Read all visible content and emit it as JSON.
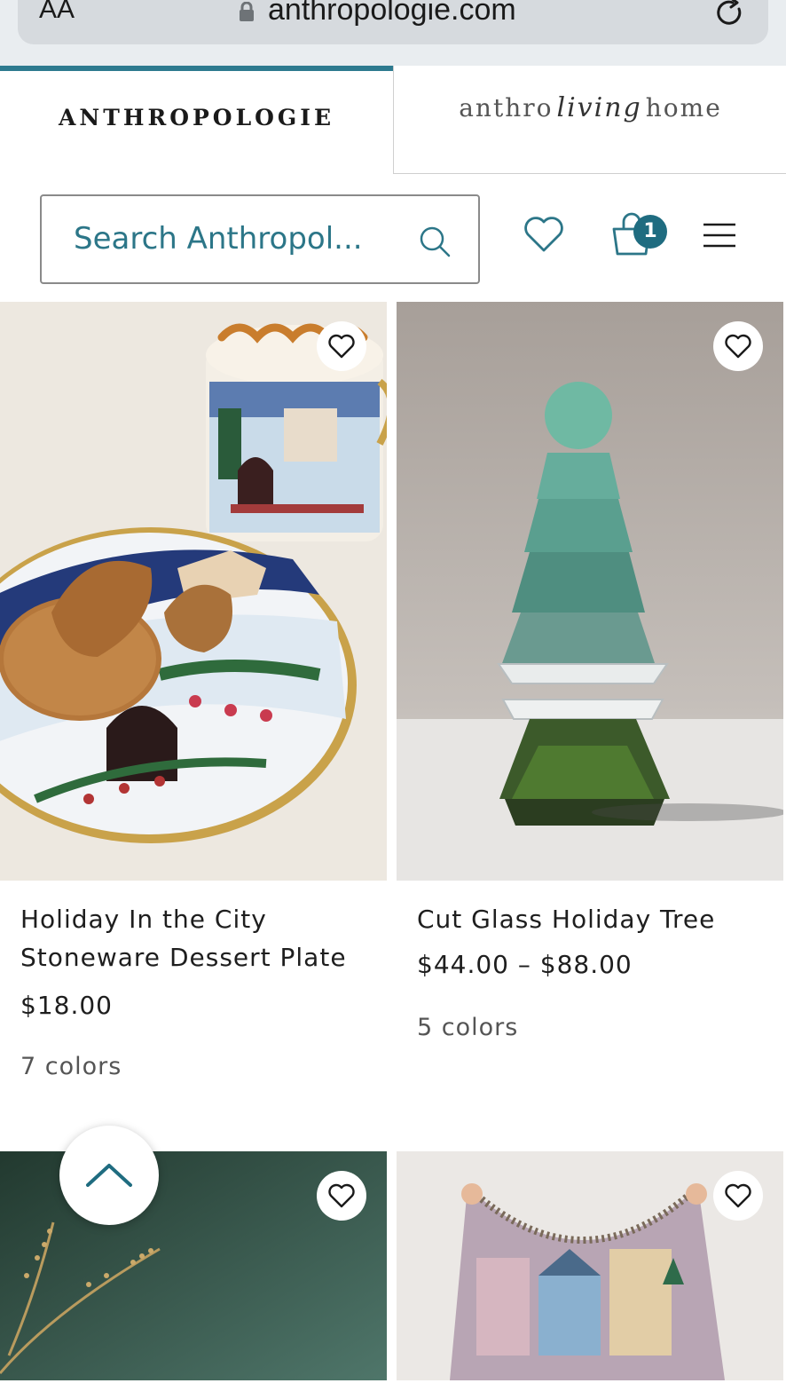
{
  "browser": {
    "text_size_label": "AA",
    "url": "anthropologie.com"
  },
  "brand_tabs": {
    "primary": "ANTHROPOLOGIE",
    "secondary_prefix": "anthro",
    "secondary_script": "living",
    "secondary_suffix": "home"
  },
  "header": {
    "search_placeholder": "Search Anthropol...",
    "bag_count": "1"
  },
  "colors": {
    "accent": "#2d7a8f",
    "badge": "#1f6c80",
    "search_text": "#2c7688"
  },
  "products": [
    {
      "name_line1": "Holiday In the City",
      "name_line2": "Stoneware Dessert Plate",
      "price": "$18.00",
      "colors": "7 colors"
    },
    {
      "name_line1": "Cut Glass Holiday Tree",
      "price": "$44.00 – $88.00",
      "colors": "5 colors"
    }
  ],
  "icons": [
    "lock-icon",
    "reload-icon",
    "search-icon",
    "heart-icon",
    "shopping-bag-icon",
    "hamburger-menu-icon",
    "chevron-up-icon"
  ]
}
